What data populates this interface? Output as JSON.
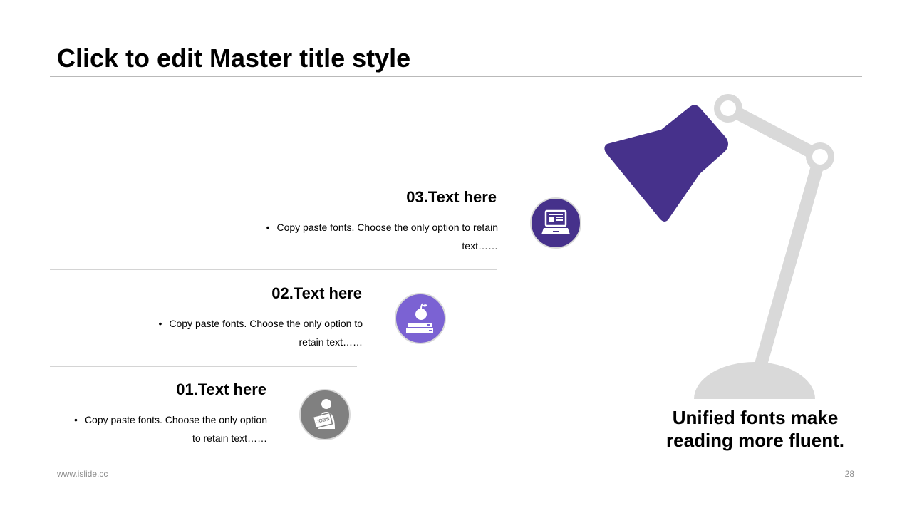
{
  "slide": {
    "title": "Click to edit Master title style",
    "footer_url": "www.islide.cc",
    "page_number": "28"
  },
  "items": [
    {
      "heading": "03.Text here",
      "bullet": "•",
      "text_line1": "Copy paste fonts. Choose the only option to retain",
      "text_line2": "text……",
      "icon": "laptop-icon",
      "color": "#46318b"
    },
    {
      "heading": "02.Text here",
      "bullet": "•",
      "text_line1": "Copy paste fonts. Choose the only option to",
      "text_line2": "retain text……",
      "icon": "apple-books-icon",
      "color": "#7b62d3"
    },
    {
      "heading": "01.Text here",
      "bullet": "•",
      "text_line1": "Copy paste fonts. Choose the only option",
      "text_line2": "to retain text……",
      "icon": "person-jobs-sign-icon",
      "color": "#808080"
    }
  ],
  "illustration": {
    "icon": "desk-lamp-icon",
    "shade_color": "#46318b",
    "arm_color": "#d9d9d9",
    "caption_line1": "Unified fonts make",
    "caption_line2": "reading more fluent."
  }
}
